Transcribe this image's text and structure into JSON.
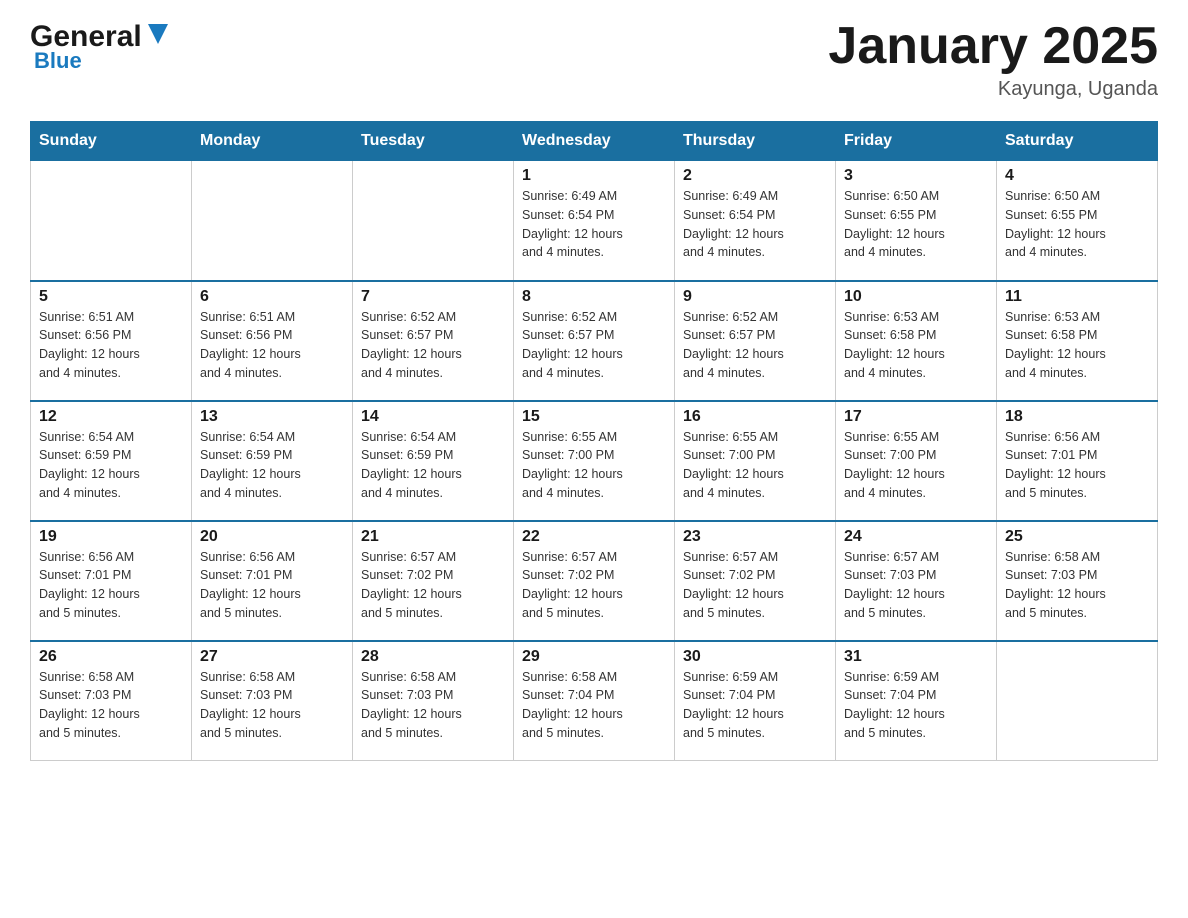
{
  "header": {
    "logo_general": "General",
    "logo_blue": "Blue",
    "month_title": "January 2025",
    "location": "Kayunga, Uganda"
  },
  "days_of_week": [
    "Sunday",
    "Monday",
    "Tuesday",
    "Wednesday",
    "Thursday",
    "Friday",
    "Saturday"
  ],
  "weeks": [
    [
      {
        "day": "",
        "info": ""
      },
      {
        "day": "",
        "info": ""
      },
      {
        "day": "",
        "info": ""
      },
      {
        "day": "1",
        "info": "Sunrise: 6:49 AM\nSunset: 6:54 PM\nDaylight: 12 hours\nand 4 minutes."
      },
      {
        "day": "2",
        "info": "Sunrise: 6:49 AM\nSunset: 6:54 PM\nDaylight: 12 hours\nand 4 minutes."
      },
      {
        "day": "3",
        "info": "Sunrise: 6:50 AM\nSunset: 6:55 PM\nDaylight: 12 hours\nand 4 minutes."
      },
      {
        "day": "4",
        "info": "Sunrise: 6:50 AM\nSunset: 6:55 PM\nDaylight: 12 hours\nand 4 minutes."
      }
    ],
    [
      {
        "day": "5",
        "info": "Sunrise: 6:51 AM\nSunset: 6:56 PM\nDaylight: 12 hours\nand 4 minutes."
      },
      {
        "day": "6",
        "info": "Sunrise: 6:51 AM\nSunset: 6:56 PM\nDaylight: 12 hours\nand 4 minutes."
      },
      {
        "day": "7",
        "info": "Sunrise: 6:52 AM\nSunset: 6:57 PM\nDaylight: 12 hours\nand 4 minutes."
      },
      {
        "day": "8",
        "info": "Sunrise: 6:52 AM\nSunset: 6:57 PM\nDaylight: 12 hours\nand 4 minutes."
      },
      {
        "day": "9",
        "info": "Sunrise: 6:52 AM\nSunset: 6:57 PM\nDaylight: 12 hours\nand 4 minutes."
      },
      {
        "day": "10",
        "info": "Sunrise: 6:53 AM\nSunset: 6:58 PM\nDaylight: 12 hours\nand 4 minutes."
      },
      {
        "day": "11",
        "info": "Sunrise: 6:53 AM\nSunset: 6:58 PM\nDaylight: 12 hours\nand 4 minutes."
      }
    ],
    [
      {
        "day": "12",
        "info": "Sunrise: 6:54 AM\nSunset: 6:59 PM\nDaylight: 12 hours\nand 4 minutes."
      },
      {
        "day": "13",
        "info": "Sunrise: 6:54 AM\nSunset: 6:59 PM\nDaylight: 12 hours\nand 4 minutes."
      },
      {
        "day": "14",
        "info": "Sunrise: 6:54 AM\nSunset: 6:59 PM\nDaylight: 12 hours\nand 4 minutes."
      },
      {
        "day": "15",
        "info": "Sunrise: 6:55 AM\nSunset: 7:00 PM\nDaylight: 12 hours\nand 4 minutes."
      },
      {
        "day": "16",
        "info": "Sunrise: 6:55 AM\nSunset: 7:00 PM\nDaylight: 12 hours\nand 4 minutes."
      },
      {
        "day": "17",
        "info": "Sunrise: 6:55 AM\nSunset: 7:00 PM\nDaylight: 12 hours\nand 4 minutes."
      },
      {
        "day": "18",
        "info": "Sunrise: 6:56 AM\nSunset: 7:01 PM\nDaylight: 12 hours\nand 5 minutes."
      }
    ],
    [
      {
        "day": "19",
        "info": "Sunrise: 6:56 AM\nSunset: 7:01 PM\nDaylight: 12 hours\nand 5 minutes."
      },
      {
        "day": "20",
        "info": "Sunrise: 6:56 AM\nSunset: 7:01 PM\nDaylight: 12 hours\nand 5 minutes."
      },
      {
        "day": "21",
        "info": "Sunrise: 6:57 AM\nSunset: 7:02 PM\nDaylight: 12 hours\nand 5 minutes."
      },
      {
        "day": "22",
        "info": "Sunrise: 6:57 AM\nSunset: 7:02 PM\nDaylight: 12 hours\nand 5 minutes."
      },
      {
        "day": "23",
        "info": "Sunrise: 6:57 AM\nSunset: 7:02 PM\nDaylight: 12 hours\nand 5 minutes."
      },
      {
        "day": "24",
        "info": "Sunrise: 6:57 AM\nSunset: 7:03 PM\nDaylight: 12 hours\nand 5 minutes."
      },
      {
        "day": "25",
        "info": "Sunrise: 6:58 AM\nSunset: 7:03 PM\nDaylight: 12 hours\nand 5 minutes."
      }
    ],
    [
      {
        "day": "26",
        "info": "Sunrise: 6:58 AM\nSunset: 7:03 PM\nDaylight: 12 hours\nand 5 minutes."
      },
      {
        "day": "27",
        "info": "Sunrise: 6:58 AM\nSunset: 7:03 PM\nDaylight: 12 hours\nand 5 minutes."
      },
      {
        "day": "28",
        "info": "Sunrise: 6:58 AM\nSunset: 7:03 PM\nDaylight: 12 hours\nand 5 minutes."
      },
      {
        "day": "29",
        "info": "Sunrise: 6:58 AM\nSunset: 7:04 PM\nDaylight: 12 hours\nand 5 minutes."
      },
      {
        "day": "30",
        "info": "Sunrise: 6:59 AM\nSunset: 7:04 PM\nDaylight: 12 hours\nand 5 minutes."
      },
      {
        "day": "31",
        "info": "Sunrise: 6:59 AM\nSunset: 7:04 PM\nDaylight: 12 hours\nand 5 minutes."
      },
      {
        "day": "",
        "info": ""
      }
    ]
  ]
}
